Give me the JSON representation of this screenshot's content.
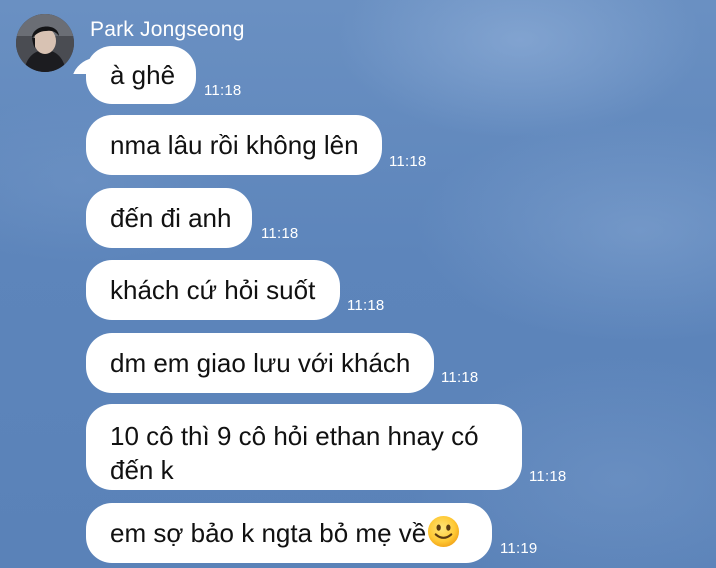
{
  "sender": {
    "name": "Park Jongseong"
  },
  "messages": [
    {
      "text": "à ghê",
      "time": "11:18"
    },
    {
      "text": "nma lâu rồi không lên",
      "time": "11:18"
    },
    {
      "text": "đến đi anh",
      "time": "11:18"
    },
    {
      "text": "khách cứ hỏi suốt",
      "time": "11:18"
    },
    {
      "text": "dm em giao lưu với khách",
      "time": "11:18"
    },
    {
      "text": "10 cô thì 9 cô hỏi ethan hnay có đến k",
      "time": "11:18"
    },
    {
      "text": "em sợ bảo k ngta bỏ mẹ về",
      "time": "11:19",
      "emoji": "slightly-smiling-face-icon"
    }
  ],
  "colors": {
    "background": "#5f87bd",
    "bubble": "#ffffff",
    "text": "#111111",
    "meta_text": "#ffffff"
  }
}
